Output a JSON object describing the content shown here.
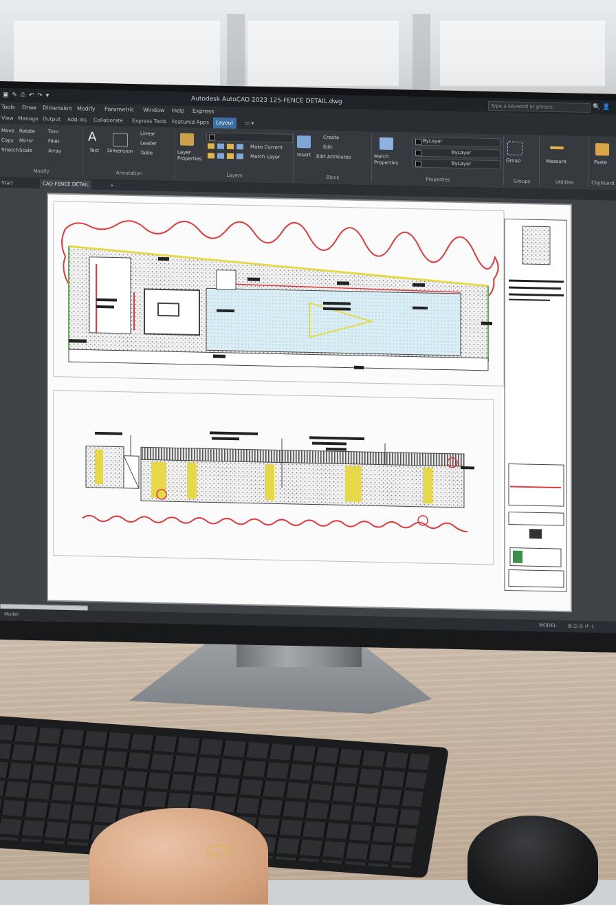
{
  "app": {
    "title": "Autodesk AutoCAD 2023   125-FENCE DETAIL.dwg",
    "search_placeholder": "Type a keyword or phrase",
    "menus": [
      "Tools",
      "Draw",
      "Dimension",
      "Modify",
      "Parametric",
      "Window",
      "Help",
      "Express"
    ],
    "tabs": [
      "View",
      "Manage",
      "Output",
      "Add-ins",
      "Collaborate",
      "Express Tools",
      "Featured Apps",
      "Layout"
    ],
    "active_tab": "Layout"
  },
  "ribbon": {
    "modify": {
      "label": "Modify",
      "items": [
        "Move",
        "Rotate",
        "Trim",
        "Copy",
        "Mirror",
        "Fillet",
        "Stretch",
        "Scale",
        "Array"
      ]
    },
    "annotation": {
      "label": "Annotation",
      "items": [
        "Text",
        "Dimension",
        "Linear",
        "Leader",
        "Table"
      ]
    },
    "layers": {
      "label": "Layers",
      "items": [
        "Layer Properties",
        "Make Current",
        "Match Layer"
      ]
    },
    "block": {
      "label": "Block",
      "items": [
        "Insert",
        "Create",
        "Edit",
        "Edit Attributes"
      ]
    },
    "properties": {
      "label": "Properties",
      "items": [
        "Match Properties",
        "ByLayer",
        "ByLayer",
        "ByLayer"
      ]
    },
    "groups": {
      "label": "Groups",
      "items": [
        "Group"
      ]
    },
    "utilities": {
      "label": "Utilities",
      "items": [
        "Measure"
      ]
    },
    "clipboard": {
      "label": "Clipboard",
      "items": [
        "Paste"
      ]
    }
  },
  "doctabs": [
    "Start",
    "CAD-FENCE DETAIL"
  ],
  "status": {
    "left": "Model",
    "right": "MODEL"
  },
  "colors": {
    "accent": "#3c6fa0",
    "redline": "#e03a3a",
    "fill_blue": "#d9edf4",
    "fill_yellow": "#e6d84a"
  }
}
